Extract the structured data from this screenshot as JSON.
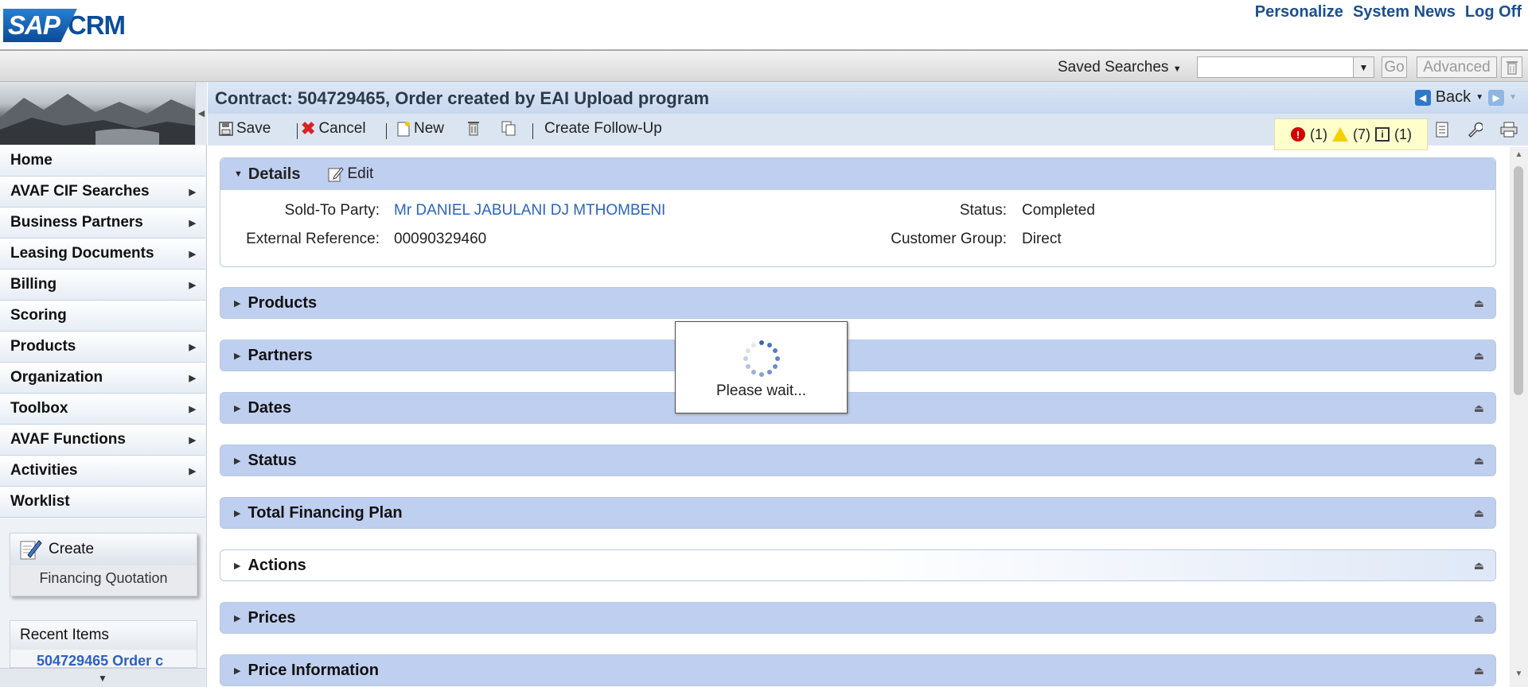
{
  "header": {
    "logo_sap": "SAP",
    "logo_crm": "CRM",
    "links": [
      "Personalize",
      "System News",
      "Log Off"
    ]
  },
  "search": {
    "saved_searches": "Saved Searches",
    "input_value": "",
    "go": "Go",
    "advanced": "Advanced"
  },
  "nav": {
    "items": [
      {
        "label": "Home",
        "arrow": false
      },
      {
        "label": "AVAF CIF Searches",
        "arrow": true
      },
      {
        "label": "Business Partners",
        "arrow": true
      },
      {
        "label": "Leasing Documents",
        "arrow": true
      },
      {
        "label": "Billing",
        "arrow": true
      },
      {
        "label": "Scoring",
        "arrow": false
      },
      {
        "label": "Products",
        "arrow": true
      },
      {
        "label": "Organization",
        "arrow": true
      },
      {
        "label": "Toolbox",
        "arrow": true
      },
      {
        "label": "AVAF Functions",
        "arrow": true
      },
      {
        "label": "Activities",
        "arrow": true
      },
      {
        "label": "Worklist",
        "arrow": false
      }
    ]
  },
  "create": {
    "title": "Create",
    "item": "Financing Quotation"
  },
  "recent": {
    "title": "Recent Items",
    "item": "504729465 Order c"
  },
  "page": {
    "title": "Contract: 504729465, Order created by EAI Upload program",
    "back": "Back"
  },
  "toolbar": {
    "save": "Save",
    "cancel": "Cancel",
    "new": "New",
    "follow_up": "Create Follow-Up"
  },
  "messages": {
    "errors": "(1)",
    "warnings": "(7)",
    "info": "(1)"
  },
  "details": {
    "title": "Details",
    "edit": "Edit",
    "sold_to_label": "Sold-To Party:",
    "sold_to_value": "Mr DANIEL JABULANI DJ MTHOMBENI",
    "ext_ref_label": "External Reference:",
    "ext_ref_value": "00090329460",
    "status_label": "Status:",
    "status_value": "Completed",
    "cust_group_label": "Customer Group:",
    "cust_group_value": "Direct"
  },
  "blocks": [
    "Products",
    "Partners",
    "Dates",
    "Status",
    "Total Financing Plan",
    "Actions",
    "Prices",
    "Price Information"
  ],
  "wait": {
    "text": "Please wait..."
  },
  "colors": {
    "accent": "#2b62c0",
    "block_header": "#bfcff0",
    "message_bg": "#ffffcc"
  }
}
